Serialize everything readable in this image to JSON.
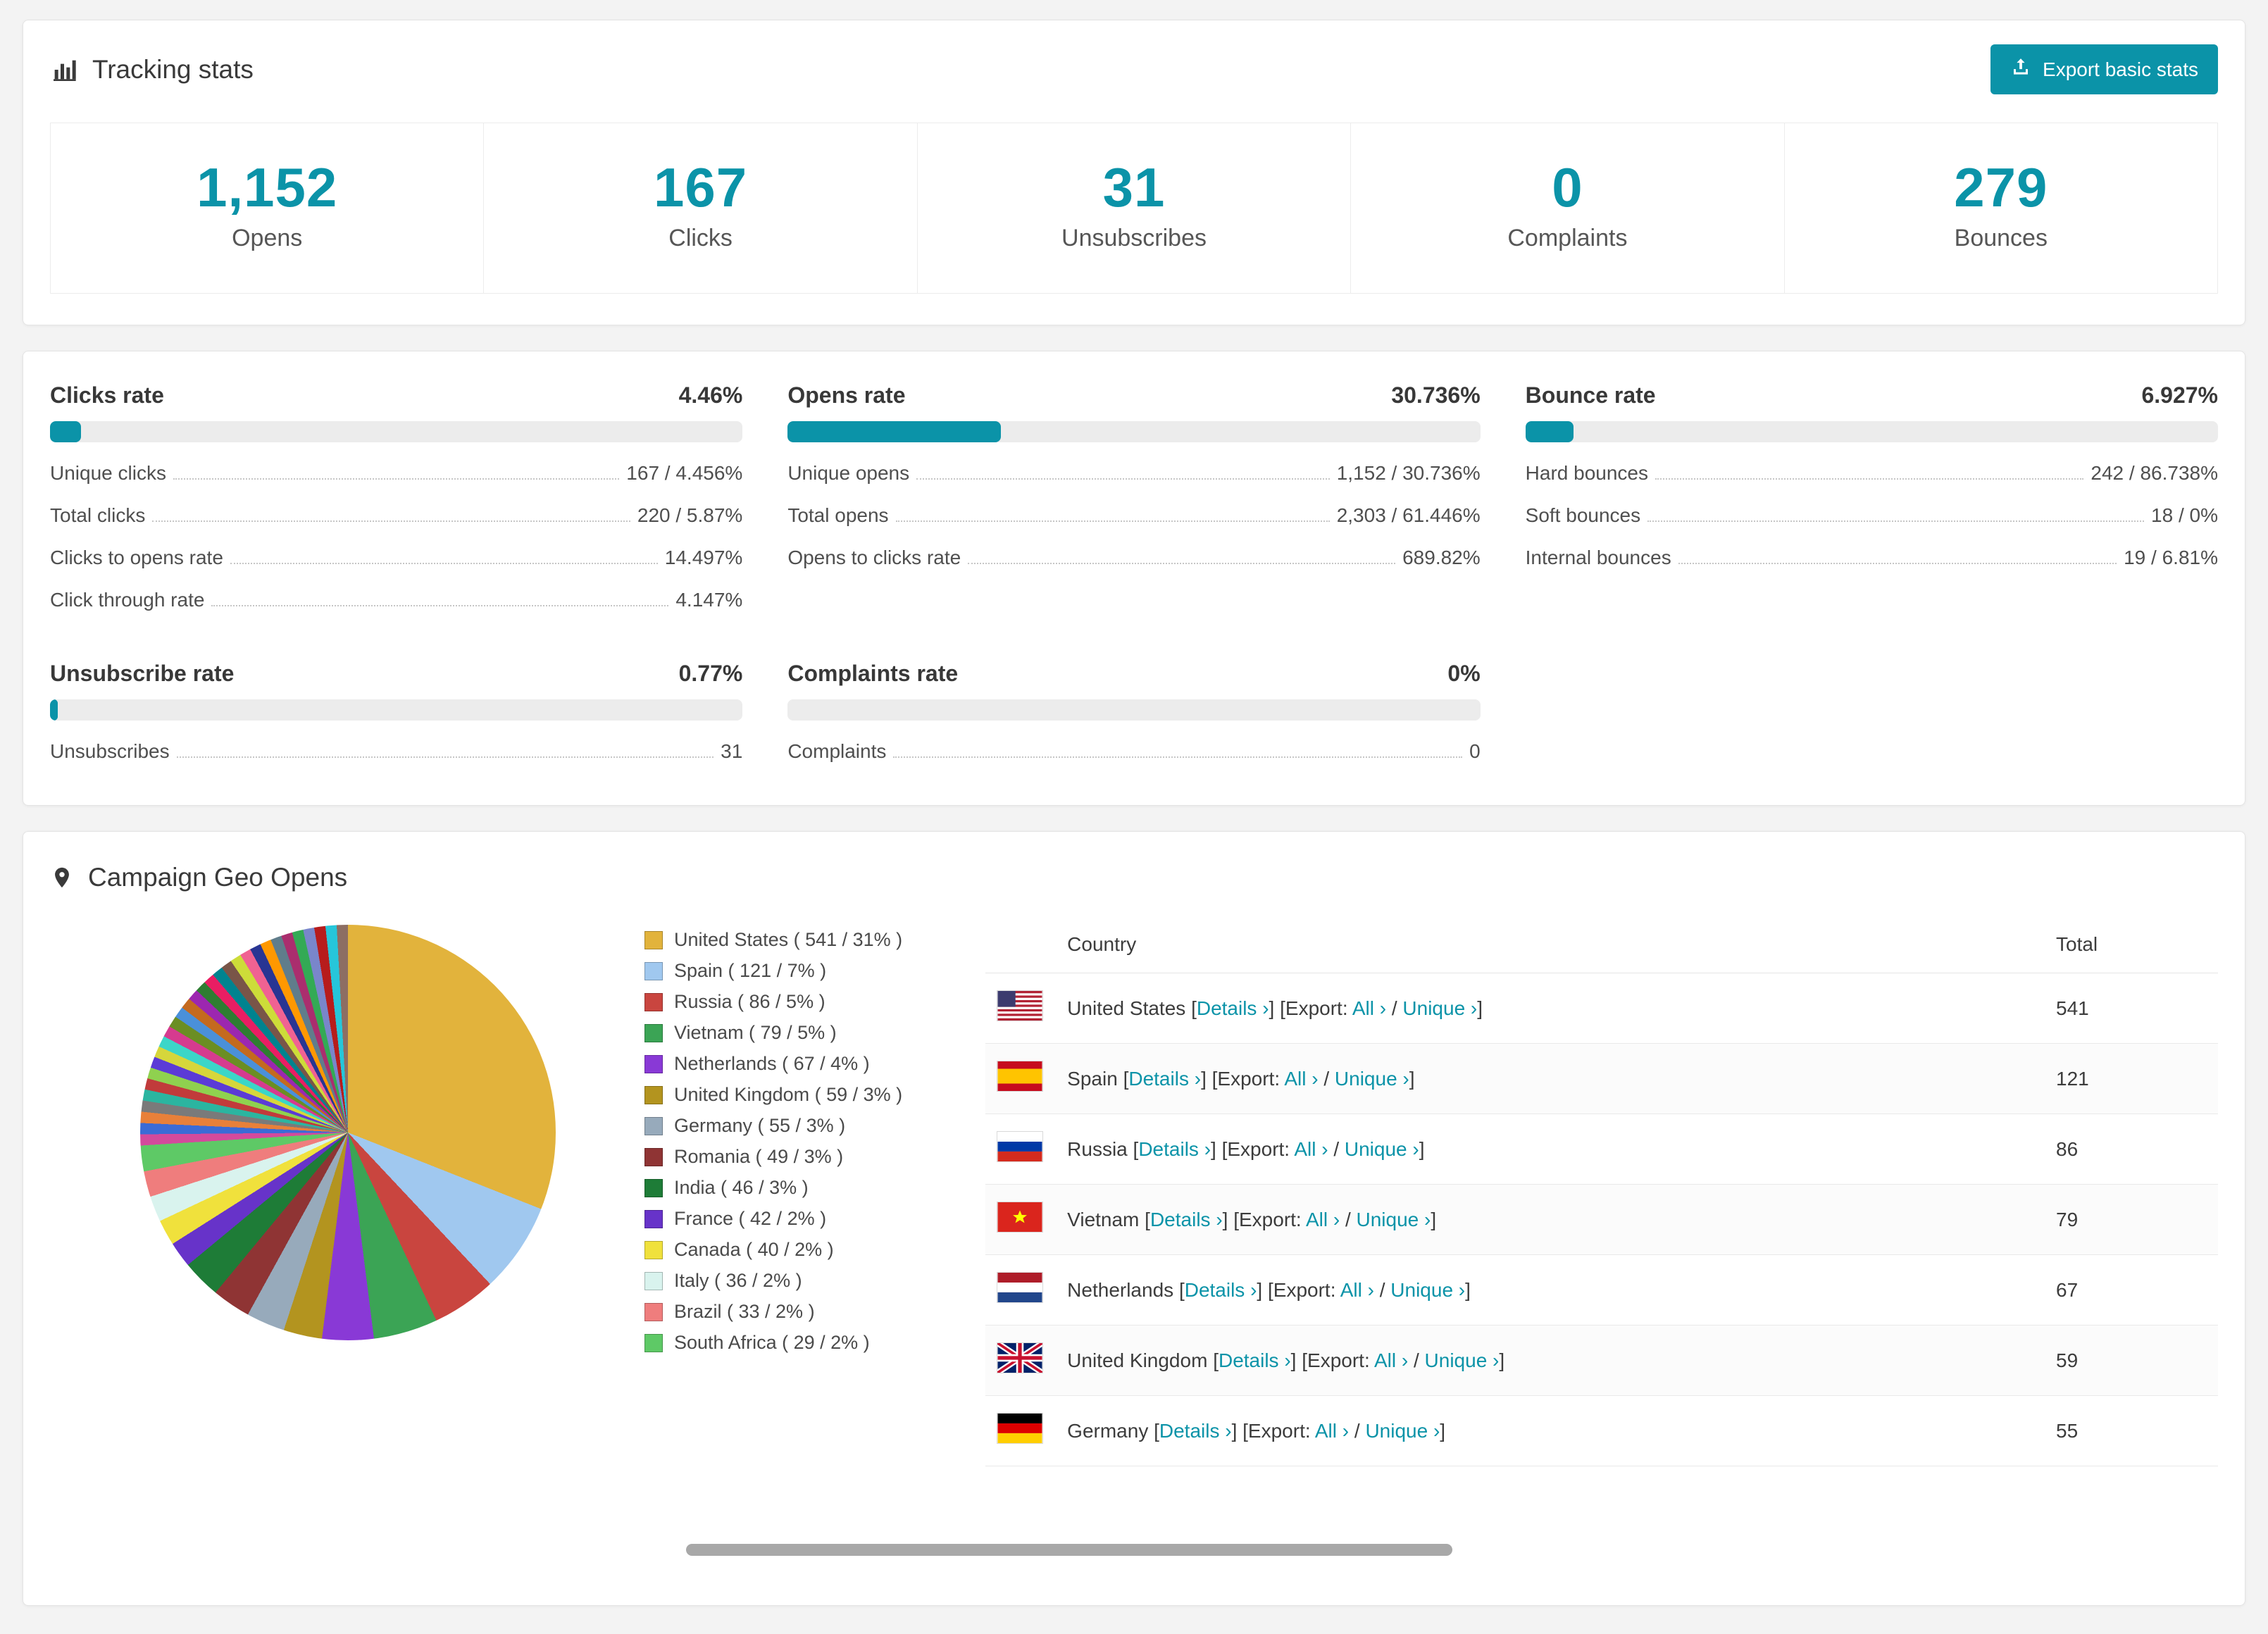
{
  "colors": {
    "accent": "#0b93a8"
  },
  "tracking": {
    "title": "Tracking stats",
    "export_label": "Export basic stats",
    "stats": [
      {
        "value": "1,152",
        "label": "Opens"
      },
      {
        "value": "167",
        "label": "Clicks"
      },
      {
        "value": "31",
        "label": "Unsubscribes"
      },
      {
        "value": "0",
        "label": "Complaints"
      },
      {
        "value": "279",
        "label": "Bounces"
      }
    ]
  },
  "rates": [
    {
      "title": "Clicks rate",
      "value": "4.46%",
      "percent": 4.46,
      "rows": [
        {
          "label": "Unique clicks",
          "value": "167 / 4.456%"
        },
        {
          "label": "Total clicks",
          "value": "220 / 5.87%"
        },
        {
          "label": "Clicks to opens rate",
          "value": "14.497%"
        },
        {
          "label": "Click through rate",
          "value": "4.147%"
        }
      ]
    },
    {
      "title": "Opens rate",
      "value": "30.736%",
      "percent": 30.736,
      "rows": [
        {
          "label": "Unique opens",
          "value": "1,152 / 30.736%"
        },
        {
          "label": "Total opens",
          "value": "2,303 / 61.446%"
        },
        {
          "label": "Opens to clicks rate",
          "value": "689.82%"
        }
      ]
    },
    {
      "title": "Bounce rate",
      "value": "6.927%",
      "percent": 6.927,
      "rows": [
        {
          "label": "Hard bounces",
          "value": "242 / 86.738%"
        },
        {
          "label": "Soft bounces",
          "value": "18 / 0%"
        },
        {
          "label": "Internal bounces",
          "value": "19 / 6.81%"
        }
      ]
    },
    {
      "title": "Unsubscribe rate",
      "value": "0.77%",
      "percent": 0.77,
      "rows": [
        {
          "label": "Unsubscribes",
          "value": "31"
        }
      ]
    },
    {
      "title": "Complaints rate",
      "value": "0%",
      "percent": 0,
      "rows": [
        {
          "label": "Complaints",
          "value": "0"
        }
      ]
    }
  ],
  "geo": {
    "title": "Campaign Geo Opens",
    "chart_data": {
      "type": "pie",
      "title": "Campaign Geo Opens",
      "slices": [
        {
          "label": "United States",
          "value": 541,
          "percent": 31,
          "color": "#e2b33c",
          "legend_text": "United States ( 541 / 31% )"
        },
        {
          "label": "Spain",
          "value": 121,
          "percent": 7,
          "color": "#a0c8ef",
          "legend_text": "Spain ( 121 / 7% )"
        },
        {
          "label": "Russia",
          "value": 86,
          "percent": 5,
          "color": "#c9453f",
          "legend_text": "Russia ( 86 / 5% )"
        },
        {
          "label": "Vietnam",
          "value": 79,
          "percent": 5,
          "color": "#3ba455",
          "legend_text": "Vietnam ( 79 / 5% )"
        },
        {
          "label": "Netherlands",
          "value": 67,
          "percent": 4,
          "color": "#8939d6",
          "legend_text": "Netherlands ( 67 / 4% )"
        },
        {
          "label": "United Kingdom",
          "value": 59,
          "percent": 3,
          "color": "#b3941f",
          "legend_text": "United Kingdom ( 59 / 3% )"
        },
        {
          "label": "Germany",
          "value": 55,
          "percent": 3,
          "color": "#97aabb",
          "legend_text": "Germany ( 55 / 3% )"
        },
        {
          "label": "Romania",
          "value": 49,
          "percent": 3,
          "color": "#8f3434",
          "legend_text": "Romania ( 49 / 3% )"
        },
        {
          "label": "India",
          "value": 46,
          "percent": 3,
          "color": "#1e7c37",
          "legend_text": "India ( 46 / 3% )"
        },
        {
          "label": "France",
          "value": 42,
          "percent": 2,
          "color": "#6733c9",
          "legend_text": "France ( 42 / 2% )"
        },
        {
          "label": "Canada",
          "value": 40,
          "percent": 2,
          "color": "#f0e13c",
          "legend_text": "Canada ( 40 / 2% )"
        },
        {
          "label": "Italy",
          "value": 36,
          "percent": 2,
          "color": "#d9f3ee",
          "legend_text": "Italy ( 36 / 2% )"
        },
        {
          "label": "Brazil",
          "value": 33,
          "percent": 2,
          "color": "#ef7d7d",
          "legend_text": "Brazil ( 33 / 2% )"
        },
        {
          "label": "South Africa",
          "value": 29,
          "percent": 2,
          "color": "#5ec966",
          "legend_text": "South Africa ( 29 / 2% )"
        }
      ],
      "others_percent": 26,
      "others_colors": [
        "#d44a9c",
        "#3b6bd6",
        "#e8803a",
        "#7a7a7a",
        "#2bb5a0",
        "#c13b3b",
        "#8fd14f",
        "#5b3bd6",
        "#d6d63b",
        "#3bd6c8",
        "#d63b8f",
        "#6b8e23",
        "#4a90d9",
        "#c46a1f",
        "#9c27b0",
        "#2e7d32",
        "#e91e63",
        "#00838f",
        "#795548",
        "#cddc39",
        "#f06292",
        "#283593",
        "#ff9800",
        "#607d8b",
        "#aa2e6e",
        "#33aa55",
        "#7986cb",
        "#b71c1c",
        "#26c6da",
        "#8d6e63"
      ]
    },
    "table": {
      "headers": {
        "country": "Country",
        "total": "Total"
      },
      "labels": {
        "open": "[",
        "close": "]",
        "details": "Details ›",
        "export": "[Export:",
        "all": "All ›",
        "slash": "/",
        "unique": "Unique ›"
      },
      "rows": [
        {
          "country": "United States",
          "total": "541"
        },
        {
          "country": "Spain",
          "total": "121"
        },
        {
          "country": "Russia",
          "total": "86"
        },
        {
          "country": "Vietnam",
          "total": "79"
        },
        {
          "country": "Netherlands",
          "total": "67"
        },
        {
          "country": "United Kingdom",
          "total": "59"
        },
        {
          "country": "Germany",
          "total": "55"
        }
      ]
    }
  }
}
